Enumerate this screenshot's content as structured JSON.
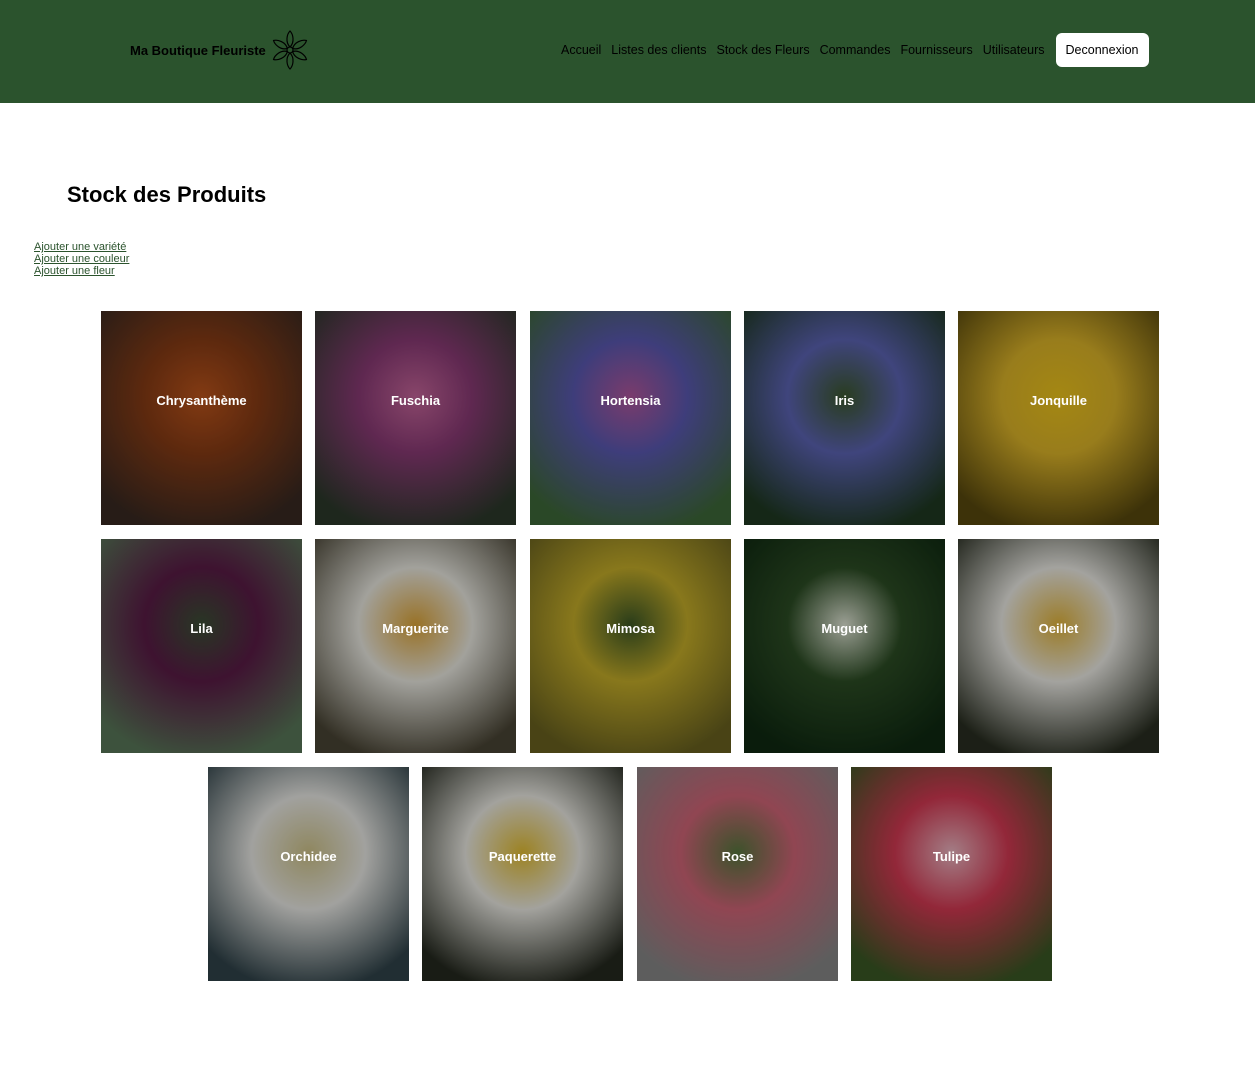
{
  "header": {
    "brand": "Ma Boutique Fleuriste",
    "bg_color": "#2b532d",
    "nav": [
      {
        "label": "Accueil"
      },
      {
        "label": "Listes des clients"
      },
      {
        "label": "Stock des Fleurs"
      },
      {
        "label": "Commandes"
      },
      {
        "label": "Fournisseurs"
      },
      {
        "label": "Utilisateurs"
      }
    ],
    "logout": "Deconnexion"
  },
  "page": {
    "title": "Stock des Produits",
    "actions": [
      {
        "label": "Ajouter une variété"
      },
      {
        "label": "Ajouter une couleur"
      },
      {
        "label": "Ajouter une fleur"
      }
    ]
  },
  "flowers": [
    {
      "name": "Chrysanthème",
      "icon": "chrysanthemum-photo",
      "colors": [
        "#3a2a22",
        "#8a3d16",
        "#c0561c"
      ]
    },
    {
      "name": "Fuschia",
      "icon": "fuchsia-photo",
      "colors": [
        "#2d3a2c",
        "#8c3b77",
        "#c9679d"
      ]
    },
    {
      "name": "Hortensia",
      "icon": "hydrangea-photo",
      "colors": [
        "#3f6a3a",
        "#5c5bb5",
        "#b458a0"
      ]
    },
    {
      "name": "Iris",
      "icon": "iris-photo",
      "colors": [
        "#1f3a22",
        "#5e66b8",
        "#3d5a2f"
      ]
    },
    {
      "name": "Jonquille",
      "icon": "daffodil-photo",
      "colors": [
        "#5a4a0e",
        "#e1b82a",
        "#f2c81c"
      ]
    },
    {
      "name": "Lila",
      "icon": "lilac-photo",
      "colors": [
        "#5b7a5a",
        "#5c1c48",
        "#3c5136"
      ]
    },
    {
      "name": "Marguerite",
      "icon": "daisy-photo",
      "colors": [
        "#4b4636",
        "#efeee6",
        "#e2a93a"
      ]
    },
    {
      "name": "Mimosa",
      "icon": "mimosa-photo",
      "colors": [
        "#6c6420",
        "#c9b12a",
        "#3e5a26"
      ]
    },
    {
      "name": "Muguet",
      "icon": "lily-of-the-valley-photo",
      "colors": [
        "#0f2a12",
        "#2d4e25",
        "#e4ead9"
      ]
    },
    {
      "name": "Oeillet",
      "icon": "daisies-photo",
      "colors": [
        "#2a2f22",
        "#f1f0ea",
        "#e6b83c"
      ]
    },
    {
      "name": "Orchidee",
      "icon": "orchid-photo",
      "colors": [
        "#32454c",
        "#eeeeea",
        "#d3c78c"
      ]
    },
    {
      "name": "Paquerette",
      "icon": "daisies-photo",
      "colors": [
        "#262a20",
        "#f0efe8",
        "#e7c133"
      ]
    },
    {
      "name": "Rose",
      "icon": "rose-photo",
      "colors": [
        "#8a8a8a",
        "#d5677a",
        "#5a7a40"
      ]
    },
    {
      "name": "Tulipe",
      "icon": "tulip-photo",
      "colors": [
        "#3b5a25",
        "#d83a54",
        "#f1b9c5"
      ]
    }
  ]
}
